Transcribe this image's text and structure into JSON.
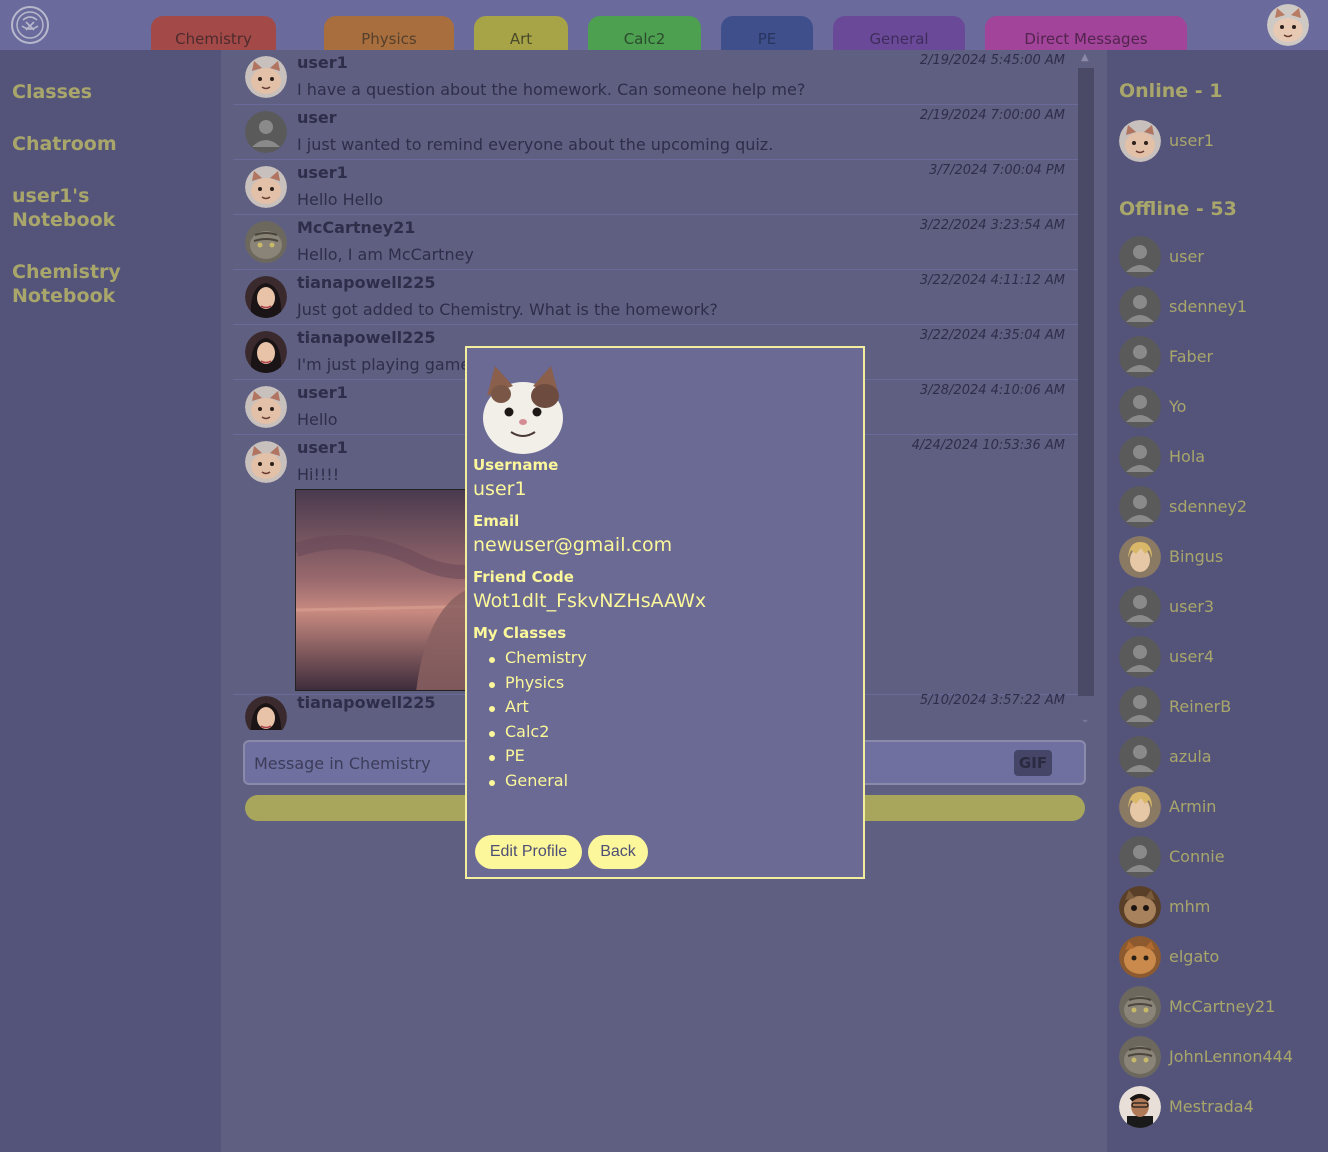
{
  "tabs": [
    {
      "label": "Chemistry",
      "bg": "#a34a48",
      "fg": "#4d2a2e"
    },
    {
      "label": "Physics",
      "bg": "#a86e3e",
      "fg": "#56402c"
    },
    {
      "label": "Art",
      "bg": "#a7a347",
      "fg": "#4a4a2a"
    },
    {
      "label": "Calc2",
      "bg": "#4ca050",
      "fg": "#2c4a2e"
    },
    {
      "label": "PE",
      "bg": "#3f4f8c",
      "fg": "#283460"
    },
    {
      "label": "General",
      "bg": "#6a4a98",
      "fg": "#3e2c5c"
    },
    {
      "label": "Direct Messages",
      "bg": "#a2449a",
      "fg": "#52244e"
    }
  ],
  "leftnav": [
    "Classes",
    "Chatroom",
    "user1's Notebook",
    "Chemistry Notebook"
  ],
  "messages": [
    {
      "user": "user1",
      "avatar": "cat",
      "time": "2/19/2024 5:45:00 AM",
      "text": "I have a question about the homework. Can someone help me?"
    },
    {
      "user": "user",
      "avatar": "default",
      "time": "2/19/2024 7:00:00 AM",
      "text": "I just wanted to remind everyone about the upcoming quiz."
    },
    {
      "user": "user1",
      "avatar": "cat",
      "time": "3/7/2024 7:00:04 PM",
      "text": "Hello Hello"
    },
    {
      "user": "McCartney21",
      "avatar": "tabby",
      "time": "3/22/2024 3:23:54 AM",
      "text": "Hello, I am McCartney"
    },
    {
      "user": "tianapowell225",
      "avatar": "woman",
      "time": "3/22/2024 4:11:12 AM",
      "text": "Just got added to Chemistry. What is the homework?"
    },
    {
      "user": "tianapowell225",
      "avatar": "woman",
      "time": "3/22/2024 4:35:04 AM",
      "text": "I'm just playing game"
    },
    {
      "user": "user1",
      "avatar": "cat",
      "time": "3/28/2024 4:10:06 AM",
      "text": "Hello"
    },
    {
      "user": "user1",
      "avatar": "cat",
      "time": "4/24/2024 10:53:36 AM",
      "text": "Hi!!!!"
    },
    {
      "user": "tianapowell225",
      "avatar": "woman",
      "time": "5/10/2024 3:57:22 AM",
      "text": ""
    }
  ],
  "input": {
    "placeholder": "Message in Chemistry",
    "gif": "GIF"
  },
  "online": {
    "title": "Online - 1",
    "members": [
      {
        "name": "user1",
        "avatar": "cat"
      }
    ]
  },
  "offline": {
    "title": "Offline - 53",
    "members": [
      {
        "name": "user",
        "avatar": "default"
      },
      {
        "name": "sdenney1",
        "avatar": "default"
      },
      {
        "name": "Faber",
        "avatar": "default"
      },
      {
        "name": "Yo",
        "avatar": "default"
      },
      {
        "name": "Hola",
        "avatar": "default"
      },
      {
        "name": "sdenney2",
        "avatar": "default"
      },
      {
        "name": "Bingus",
        "avatar": "blond"
      },
      {
        "name": "user3",
        "avatar": "default"
      },
      {
        "name": "user4",
        "avatar": "default"
      },
      {
        "name": "ReinerB",
        "avatar": "default"
      },
      {
        "name": "azula",
        "avatar": "default"
      },
      {
        "name": "Armin",
        "avatar": "blond"
      },
      {
        "name": "Connie",
        "avatar": "default"
      },
      {
        "name": "mhm",
        "avatar": "cat2"
      },
      {
        "name": "elgato",
        "avatar": "orange"
      },
      {
        "name": "McCartney21",
        "avatar": "tabby"
      },
      {
        "name": "JohnLennon444",
        "avatar": "tabby"
      },
      {
        "name": "Mestrada4",
        "avatar": "man"
      }
    ]
  },
  "modal": {
    "username_label": "Username",
    "username": "user1",
    "email_label": "Email",
    "email": "newuser@gmail.com",
    "friend_code_label": "Friend Code",
    "friend_code": "Wot1dlt_FskvNZHsAAWx",
    "classes_label": "My Classes",
    "classes": [
      "Chemistry",
      "Physics",
      "Art",
      "Calc2",
      "PE",
      "General"
    ],
    "edit_label": "Edit Profile",
    "back_label": "Back"
  }
}
